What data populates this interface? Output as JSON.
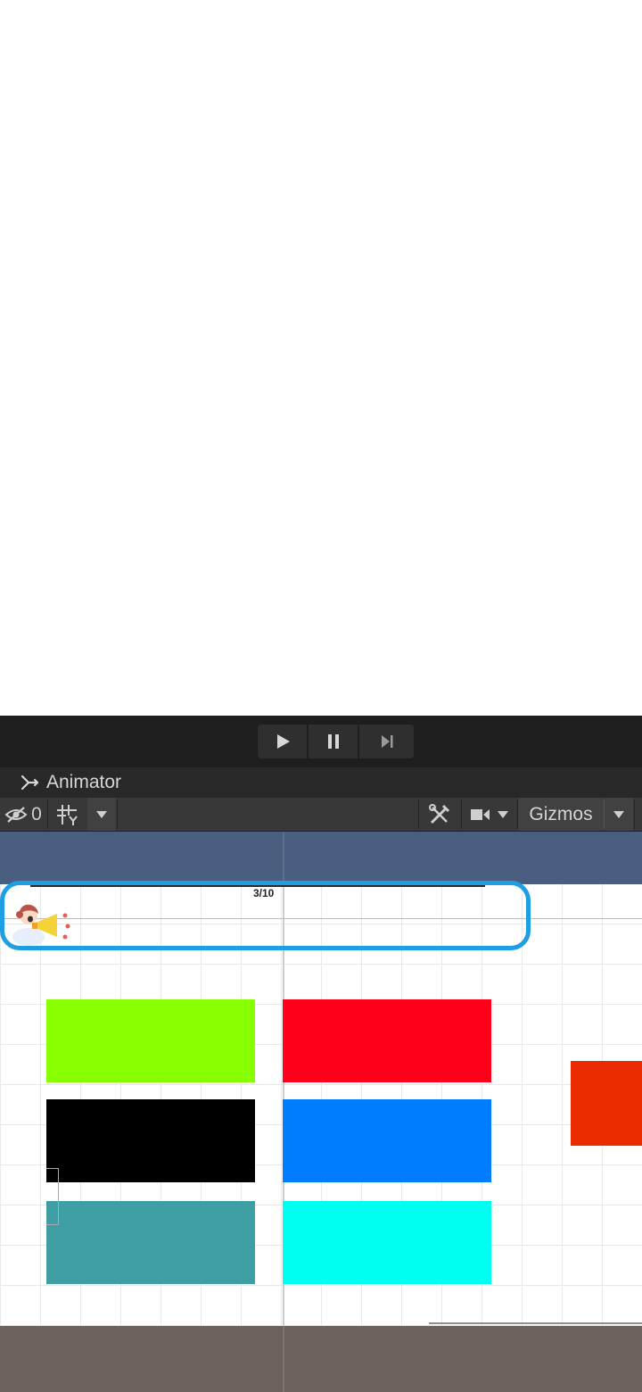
{
  "playbar": {
    "play_icon": "play-icon",
    "pause_icon": "pause-icon",
    "step_icon": "step-forward-icon"
  },
  "tab": {
    "label": "Animator",
    "icon": "animator-icon"
  },
  "toolbar": {
    "hidden_count": "0",
    "gizmos_label": "Gizmos"
  },
  "scene": {
    "counter": "3/10",
    "header_color": "#4a5e80",
    "notice_border_color": "#1e9ee3",
    "swatches": [
      {
        "color": "#88ff00"
      },
      {
        "color": "#ff001a"
      },
      {
        "color": "#000000"
      },
      {
        "color": "#007dff"
      },
      {
        "color": "#3f9da4"
      },
      {
        "color": "#00fff0"
      }
    ],
    "side_block_color": "#ea2a00"
  },
  "footer": {
    "color": "#6b625b"
  }
}
